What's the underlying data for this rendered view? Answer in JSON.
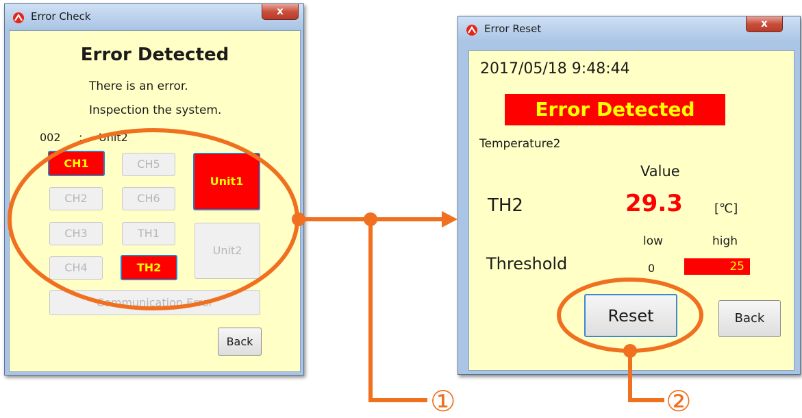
{
  "error_check": {
    "title": "Error Check",
    "close_glyph": "x",
    "heading": "Error Detected",
    "message_line1": "There is an error.",
    "message_line2": "Inspection the system.",
    "unit_code": "002",
    "unit_sep": ":",
    "unit_name": "Unit2",
    "channels": {
      "ch1": "CH1",
      "ch2": "CH2",
      "ch3": "CH3",
      "ch4": "CH4",
      "ch5": "CH5",
      "ch6": "CH6",
      "th1": "TH1",
      "th2": "TH2"
    },
    "unit1": "Unit1",
    "unit2": "Unit2",
    "comm_error": "Communication Error",
    "back": "Back"
  },
  "error_reset": {
    "title": "Error Reset",
    "close_glyph": "x",
    "timestamp": "2017/05/18 9:48:44",
    "banner": "Error Detected",
    "sensor": "Temperature2",
    "value_header": "Value",
    "channel": "TH2",
    "value": "29.3",
    "unit": "[℃]",
    "low_label": "low",
    "high_label": "high",
    "threshold_label": "Threshold",
    "low_value": "0",
    "high_value": "25",
    "reset": "Reset",
    "back": "Back"
  },
  "annotations": {
    "step1": "①",
    "step2": "②",
    "color": "#f07020"
  },
  "colors": {
    "panel_bg": "#ffffc6",
    "error_red": "#ff0000",
    "error_text": "#ffff00"
  }
}
